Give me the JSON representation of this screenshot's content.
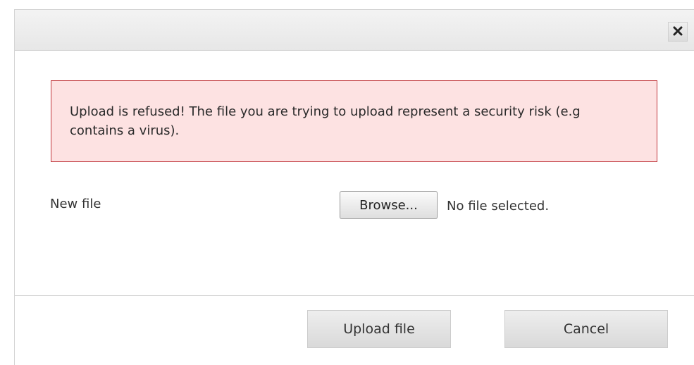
{
  "dialog": {
    "close_icon": "close-x-icon"
  },
  "alert": {
    "message": "Upload is refused! The file you are trying to upload represent a security risk (e.g contains a virus).",
    "color_bg": "#fde2e2",
    "color_border": "#c0353a"
  },
  "form": {
    "new_file_label": "New file",
    "browse_label": "Browse...",
    "file_status": "No file selected."
  },
  "actions": {
    "upload_label": "Upload file",
    "cancel_label": "Cancel"
  }
}
